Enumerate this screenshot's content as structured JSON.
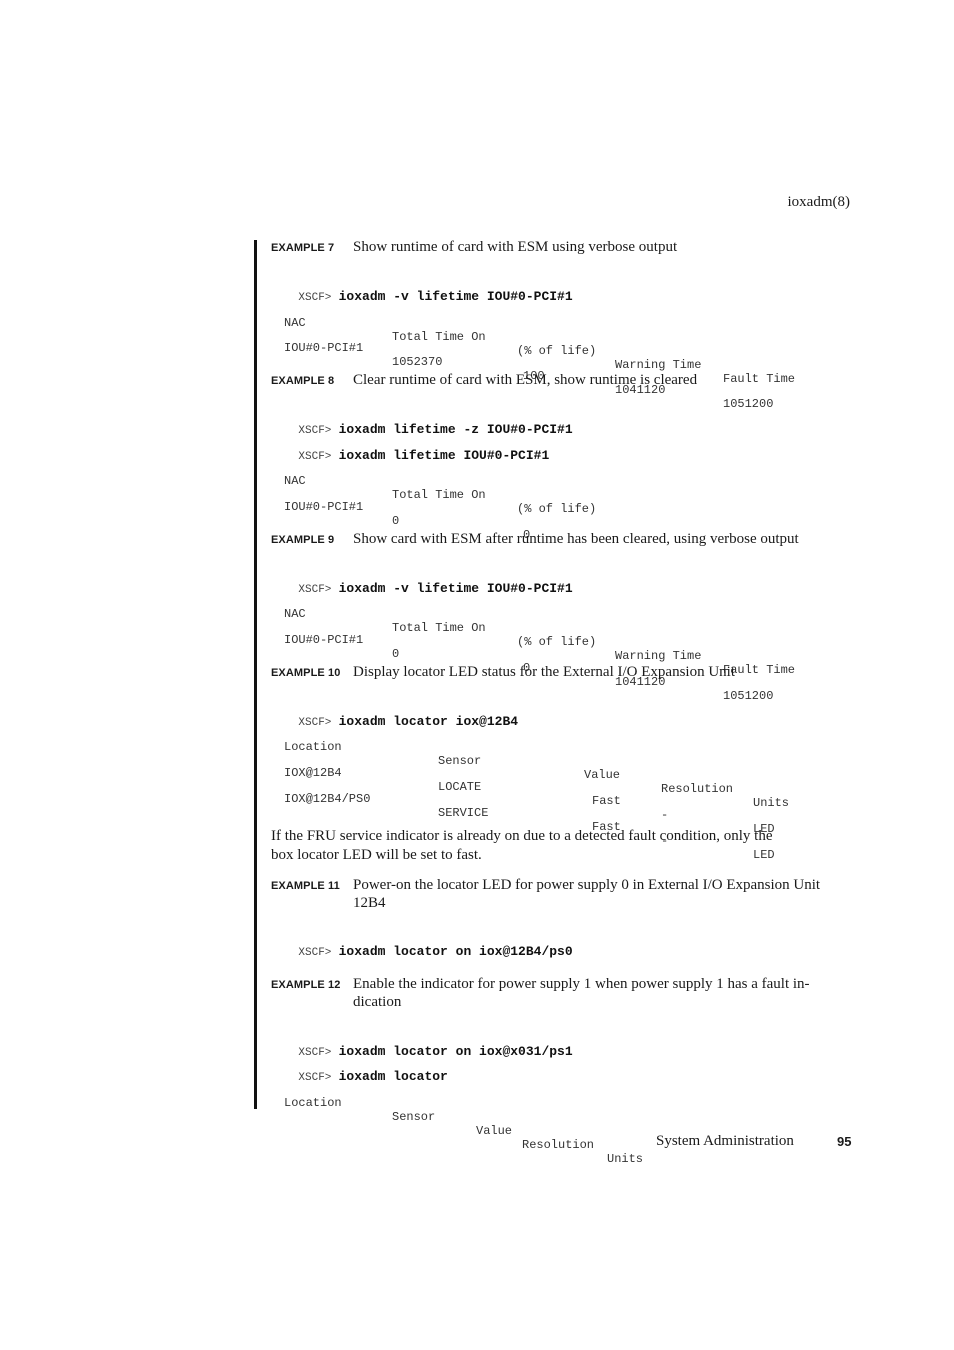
{
  "header": {
    "running_title": "ioxadm(8)"
  },
  "examples": [
    {
      "label": "EXAMPLE 7",
      "title": "Show runtime of card with ESM using verbose output",
      "commands": [
        {
          "prompt": "XSCF>",
          "command": "ioxadm -v lifetime IOU#0-PCI#1"
        }
      ],
      "table": {
        "headers": [
          "NAC",
          "Total Time On",
          "(% of life)",
          "Warning Time",
          "Fault Time"
        ],
        "rows": [
          [
            "IOU#0-PCI#1",
            "1052370",
            "100",
            "1041120",
            "1051200"
          ]
        ]
      }
    },
    {
      "label": "EXAMPLE 8",
      "title": "Clear runtime of card with ESM, show runtime is cleared",
      "commands": [
        {
          "prompt": "XSCF>",
          "command": "ioxadm lifetime -z IOU#0-PCI#1"
        },
        {
          "prompt": "XSCF>",
          "command": "ioxadm lifetime IOU#0-PCI#1"
        }
      ],
      "table": {
        "headers": [
          "NAC",
          "Total Time On",
          "(% of life)"
        ],
        "rows": [
          [
            "IOU#0-PCI#1",
            "0",
            "0"
          ]
        ]
      }
    },
    {
      "label": "EXAMPLE 9",
      "title": "Show card with ESM after runtime has been cleared, using verbose output",
      "commands": [
        {
          "prompt": "XSCF>",
          "command": "ioxadm -v lifetime IOU#0-PCI#1"
        }
      ],
      "table": {
        "headers": [
          "NAC",
          "Total Time On",
          "(% of life)",
          "Warning Time",
          "Fault Time"
        ],
        "rows": [
          [
            "IOU#0-PCI#1",
            "0",
            "0",
            "1041120",
            "1051200"
          ]
        ]
      }
    },
    {
      "label": "EXAMPLE 10",
      "title": "Display locator LED status for the External I/O Expansion Unit",
      "commands": [
        {
          "prompt": "XSCF>",
          "command": "ioxadm locator iox@12B4"
        }
      ],
      "table": {
        "headers": [
          "Location",
          "Sensor",
          "Value",
          "Resolution",
          "Units"
        ],
        "rows": [
          [
            "IOX@12B4",
            "LOCATE",
            "Fast",
            "-",
            "LED"
          ],
          [
            "IOX@12B4/PS0",
            "SERVICE",
            "Fast",
            "-",
            "LED"
          ]
        ]
      }
    },
    {
      "label": "EXAMPLE 11",
      "title_line1": "Power-on the locator LED for power supply 0 in External I/O Expansion Unit",
      "title_line2": "12B4",
      "commands": [
        {
          "prompt": "XSCF>",
          "command": "ioxadm locator on iox@12B4/ps0"
        }
      ]
    },
    {
      "label": "EXAMPLE 12",
      "title_line1": "Enable the indicator for power supply 1 when power supply 1 has a fault in-",
      "title_line2": "dication",
      "commands": [
        {
          "prompt": "XSCF>",
          "command": "ioxadm locator on iox@x031/ps1"
        },
        {
          "prompt": "XSCF>",
          "command": "ioxadm locator"
        }
      ],
      "table": {
        "headers": [
          "Location",
          "Sensor",
          "Value",
          "Resolution",
          "Units"
        ],
        "rows": []
      }
    }
  ],
  "paragraph": {
    "line1": "If the FRU service indicator is already on due to a detected fault condition, only the",
    "line2": "box locator LED will be set to fast."
  },
  "footer": {
    "section_title": "System Administration",
    "page_number": "95"
  }
}
